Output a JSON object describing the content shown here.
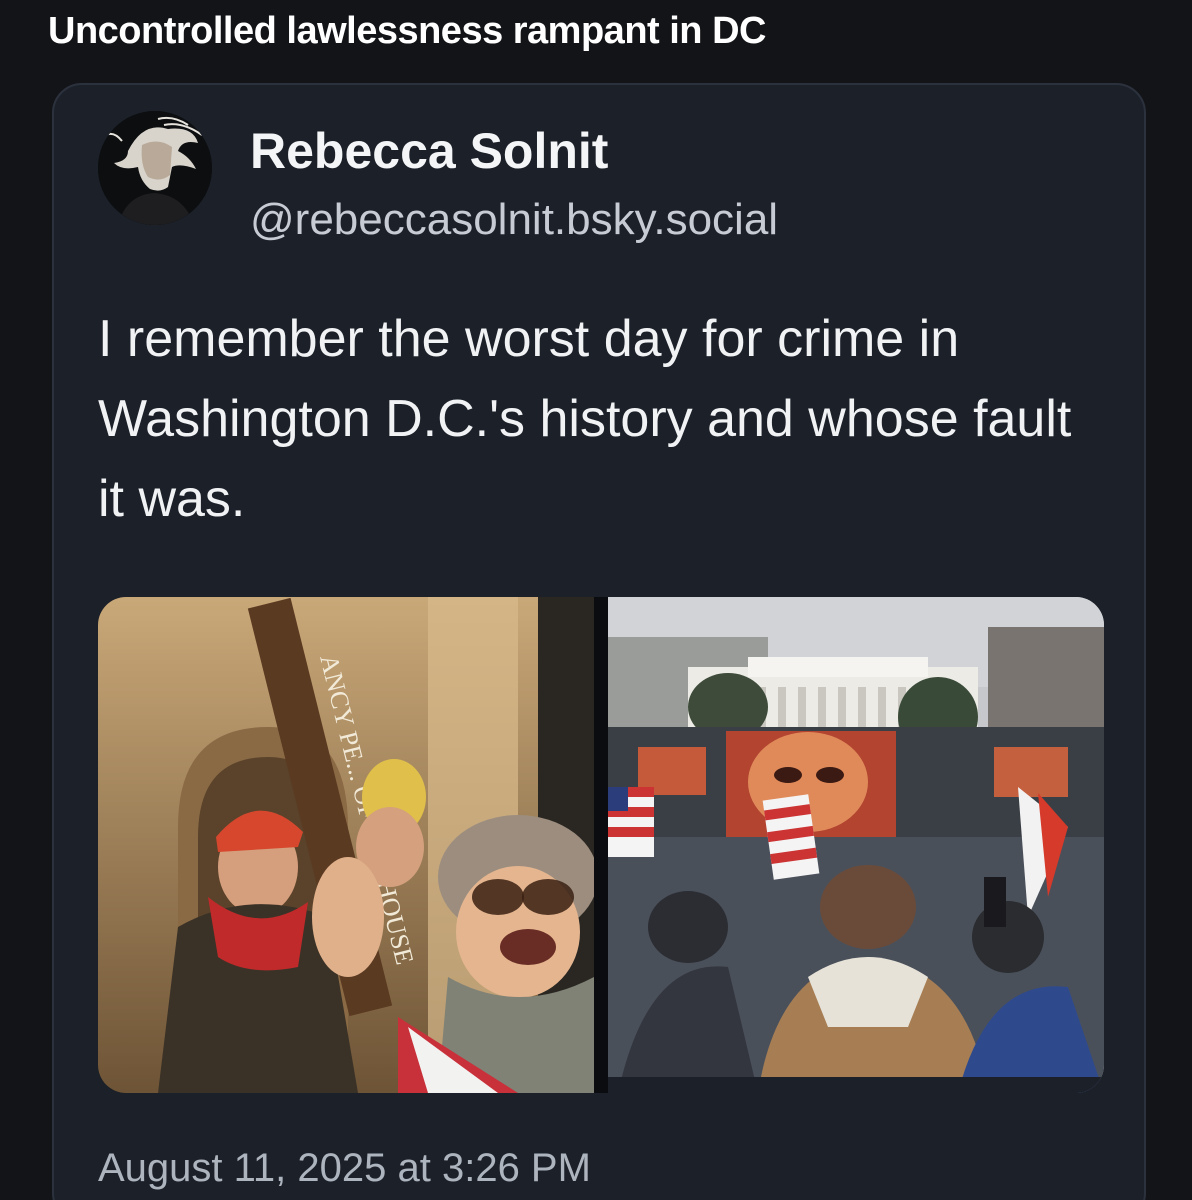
{
  "header": {
    "title": "Uncontrolled lawlessness rampant in DC"
  },
  "post": {
    "author_name": "Rebecca Solnit",
    "author_handle": "@rebeccasolnit.bsky.social",
    "text": "I remember the worst day for crime in Washington D.C.'s history and whose fault it was.",
    "timestamp": "August 11, 2025 at 3:26 PM",
    "media": {
      "left_photo_sign_text": "ANCY PE... OF THE HOUSE"
    }
  },
  "colors": {
    "page_background": "#131417",
    "card_background": "#1b2029",
    "card_border": "#2c323d",
    "handle_text": "#c7ccd4",
    "timestamp_text": "#aeb4bd"
  }
}
